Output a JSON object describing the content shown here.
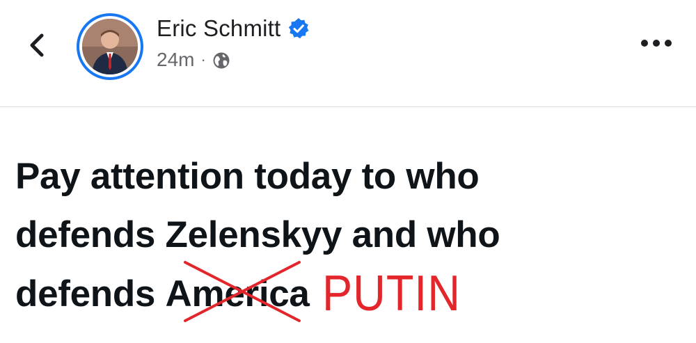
{
  "header": {
    "author_name": "Eric Schmitt",
    "timestamp": "24m",
    "separator": "·",
    "audience_icon": "globe-icon",
    "verified_icon": "verified-badge-icon",
    "back_icon": "chevron-left-icon",
    "more_icon": "more-horizontal-icon"
  },
  "post": {
    "line1": "Pay attention today to who",
    "line2": "defends Zelenskyy and who",
    "line3_prefix": "defends ",
    "line3_struck": "America",
    "annotation": "PUTIN"
  },
  "colors": {
    "accent": "#1877f2",
    "annotation": "#e3262b",
    "text": "#0f1419",
    "meta": "#65676b"
  }
}
